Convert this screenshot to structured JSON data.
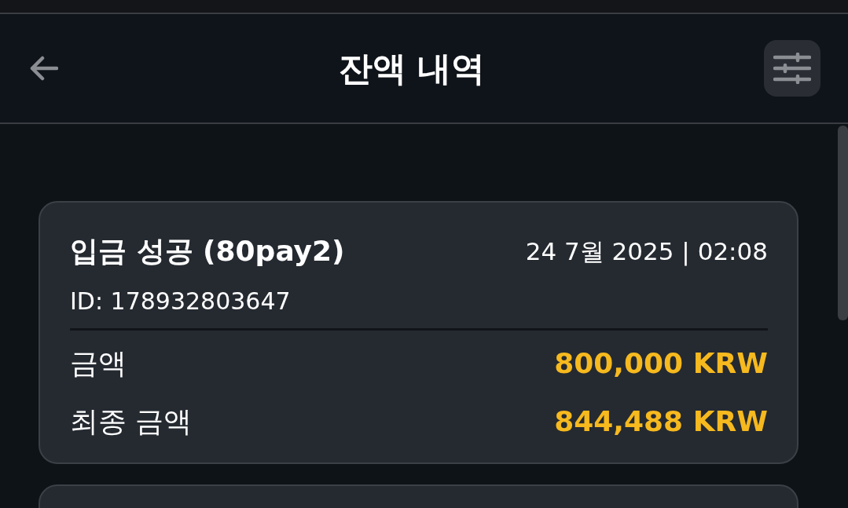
{
  "header": {
    "title": "잔액 내역"
  },
  "transactions": [
    {
      "title": "입금 성공 (80pay2)",
      "date": "24 7월 2025 | 02:08",
      "id": "ID: 178932803647",
      "amounts": [
        {
          "label": "금액",
          "value": "800,000 KRW"
        },
        {
          "label": "최종 금액",
          "value": "844,488 KRW"
        }
      ]
    }
  ]
}
